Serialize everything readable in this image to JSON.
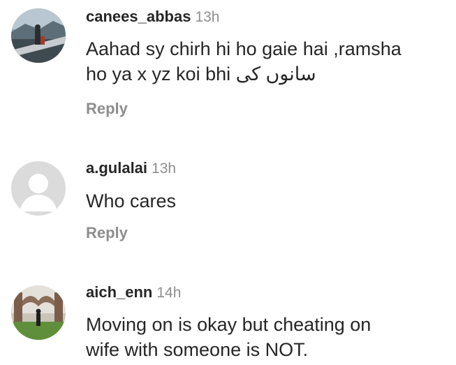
{
  "comments": [
    {
      "username": "canees_abbas",
      "time": "13h",
      "text_line1": "Aahad sy chirh hi ho gaie hai ,ramsha",
      "text_line2": "ho ya x yz koi bhi سانوں کی",
      "reply_label": "Reply",
      "avatar": "photo-avatar-bridge"
    },
    {
      "username": "a.gulalai",
      "time": "13h",
      "text_line1": "Who cares",
      "reply_label": "Reply",
      "avatar": "default-avatar-icon"
    },
    {
      "username": "aich_enn",
      "time": "14h",
      "text_line1": "Moving on is okay but cheating on",
      "text_line2": "wife with someone is NOT.",
      "avatar": "photo-avatar-arches"
    }
  ]
}
